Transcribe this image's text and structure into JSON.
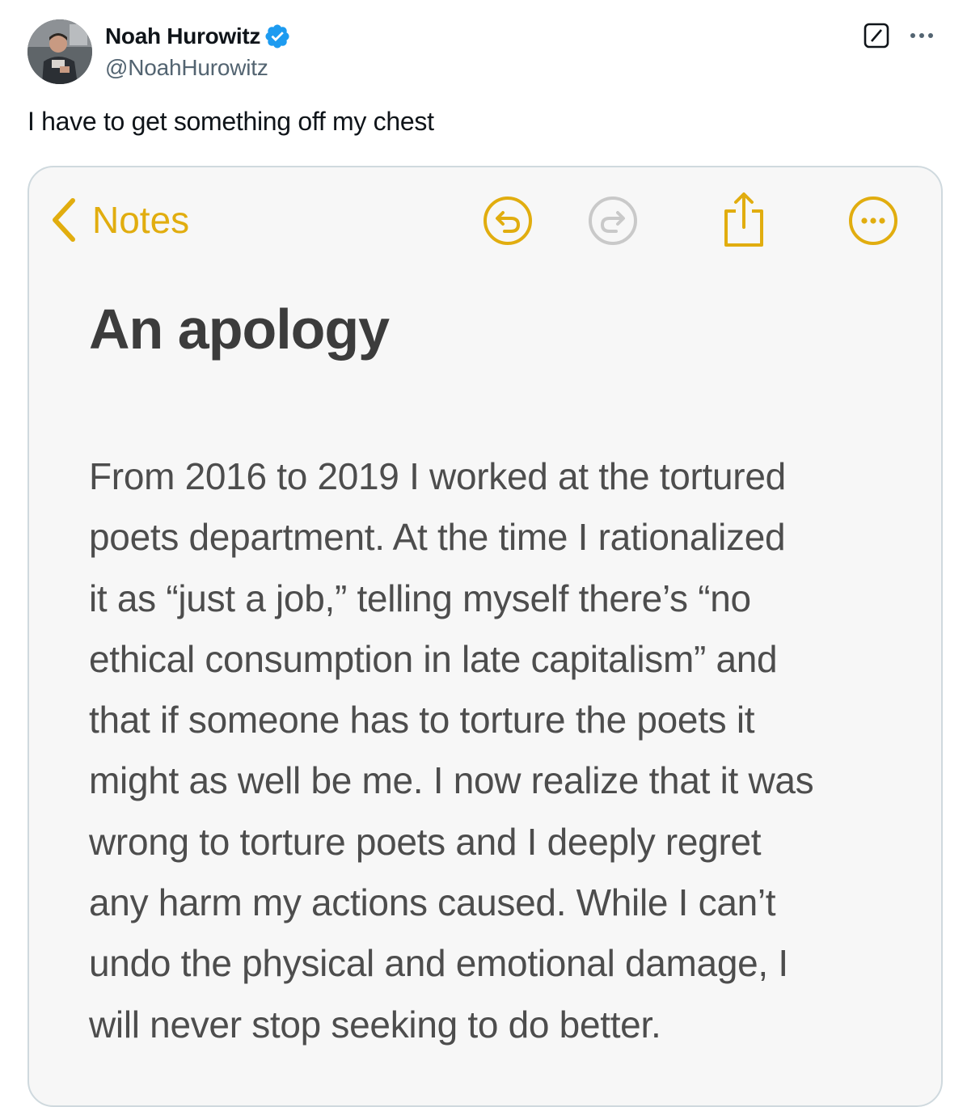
{
  "tweet": {
    "author": {
      "display_name": "Noah Hurowitz",
      "handle": "@NoahHurowitz",
      "verified": true,
      "avatar_icon": "user-avatar"
    },
    "actions": {
      "grok_icon": "grok-icon",
      "more_icon": "more-options-icon"
    },
    "text": "I have to get something off my chest"
  },
  "notes_app": {
    "nav": {
      "back_label": "Notes",
      "icons": [
        "undo-icon",
        "redo-icon",
        "share-icon",
        "more-icon"
      ]
    },
    "title": "An apology",
    "body_lines": [
      "From 2016 to 2019 I worked at the tortured",
      "poets department. At the time I rationalized",
      "it as “just a job,”  telling myself there’s “no",
      "ethical consumption in late capitalism” and",
      "that if someone has to torture the poets it",
      "might as well be me. I now realize that it was",
      "wrong to torture poets and I deeply regret",
      "any harm my actions caused. While I can’t",
      "undo the physical and emotional damage, I",
      "will never stop seeking to do better."
    ]
  },
  "colors": {
    "accent": "#e1ad0f",
    "verified": "#1d9bf0",
    "text_primary": "#0f1419",
    "text_secondary": "#536471",
    "border": "#cfd9de",
    "note_text": "#4d4d4d"
  }
}
